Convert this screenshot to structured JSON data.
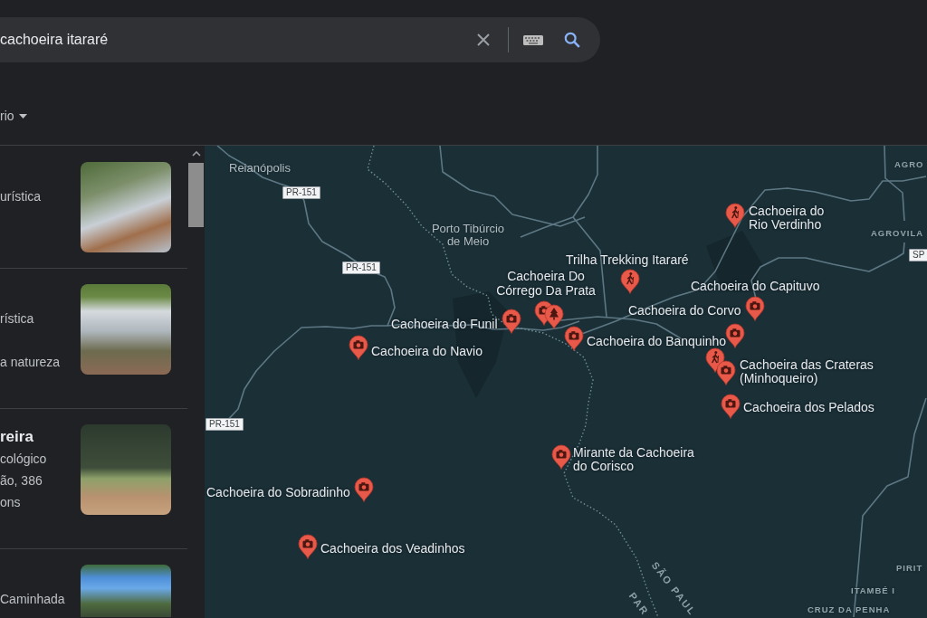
{
  "search": {
    "value": "cachoeira itararé"
  },
  "filter": {
    "label": "rio"
  },
  "results": [
    {
      "lines": [
        "urística"
      ]
    },
    {
      "lines": [
        "rística",
        "a natureza"
      ]
    },
    {
      "title": "reira",
      "lines": [
        "cológico",
        "ão, 386",
        "ons"
      ]
    },
    {
      "lines": [
        "Caminhada"
      ]
    }
  ],
  "map": {
    "places": [
      "Reianópolis",
      "Porto Tibúrcio de Meio"
    ],
    "road_shields": [
      "PR-151",
      "PR-151",
      "PR-151",
      "SP"
    ],
    "areas": [
      "AGRO",
      "AGROVILA",
      "PIRIT",
      "ITAMBÉ I",
      "CRUZ DA PENHA"
    ],
    "border_labels": [
      "SÃO PAUL",
      "PAR"
    ],
    "pois": [
      {
        "label": "Cachoeira do Rio Verdinho",
        "pins": [
          {
            "kind": "hiker"
          }
        ]
      },
      {
        "label": "Trilha Trekking Itararé",
        "pins": [
          {
            "kind": "hiker"
          }
        ]
      },
      {
        "label": "Cachoeira Do Córrego Da Prata",
        "pins": [
          {
            "kind": "camera"
          },
          {
            "kind": "tree"
          }
        ]
      },
      {
        "label": "Cachoeira do Capituvo"
      },
      {
        "label": "Cachoeira do Corvo",
        "pins": [
          {
            "kind": "camera"
          }
        ]
      },
      {
        "label": "Cachoeira do Funil",
        "pins": [
          {
            "kind": "camera"
          }
        ]
      },
      {
        "label": "Cachoeira do Banquinho",
        "pins": [
          {
            "kind": "camera"
          }
        ]
      },
      {
        "pins": [
          {
            "kind": "camera"
          }
        ]
      },
      {
        "label": "Cachoeira do Navio",
        "pins": [
          {
            "kind": "camera"
          }
        ]
      },
      {
        "label": "Cachoeira das Crateras (Minhoqueiro)",
        "pins": [
          {
            "kind": "hiker"
          },
          {
            "kind": "camera"
          }
        ]
      },
      {
        "label": "Cachoeira dos Pelados",
        "pins": [
          {
            "kind": "camera"
          }
        ]
      },
      {
        "label": "Mirante da Cachoeira do Corisco",
        "pins": [
          {
            "kind": "camera"
          }
        ]
      },
      {
        "label": "Cachoeira do Sobradinho",
        "pins": [
          {
            "kind": "camera"
          }
        ]
      },
      {
        "label": "Cachoeira dos Veadinhos",
        "pins": [
          {
            "kind": "camera"
          }
        ]
      }
    ]
  }
}
